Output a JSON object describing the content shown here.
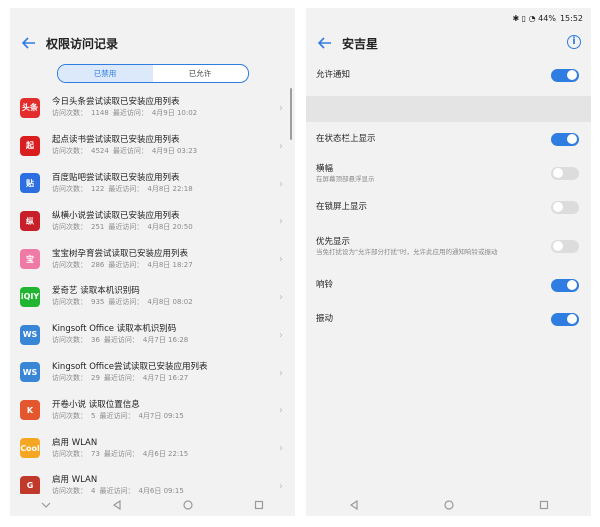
{
  "left": {
    "title": "权限访问记录",
    "tabs": [
      {
        "label": "已禁用",
        "active": true
      },
      {
        "label": "已允许",
        "active": false
      }
    ],
    "items": [
      {
        "app": "今日头条",
        "title": "今日头条尝试读取已安装应用列表",
        "count_label": "访问次数：",
        "count": "1148",
        "last_label": "最近访问：",
        "last": "4月9日 10:02",
        "icon_color": "#e32d2d",
        "icon_text": "头条"
      },
      {
        "app": "起点读书",
        "title": "起点读书尝试读取已安装应用列表",
        "count_label": "访问次数：",
        "count": "4524",
        "last_label": "最近访问：",
        "last": "4月9日 03:23",
        "icon_color": "#d81e1e",
        "icon_text": "起"
      },
      {
        "app": "百度贴吧",
        "title": "百度贴吧尝试读取已安装应用列表",
        "count_label": "访问次数：",
        "count": "122",
        "last_label": "最近访问：",
        "last": "4月8日 22:18",
        "icon_color": "#2d6fe0",
        "icon_text": "贴"
      },
      {
        "app": "纵横小说",
        "title": "纵横小说尝试读取已安装应用列表",
        "count_label": "访问次数：",
        "count": "251",
        "last_label": "最近访问：",
        "last": "4月8日 20:50",
        "icon_color": "#c8202a",
        "icon_text": "纵"
      },
      {
        "app": "宝宝树孕育",
        "title": "宝宝树孕育尝试读取已安装应用列表",
        "count_label": "访问次数：",
        "count": "286",
        "last_label": "最近访问：",
        "last": "4月8日 18:27",
        "icon_color": "#ee7aa5",
        "icon_text": "宝"
      },
      {
        "app": "爱奇艺",
        "title": "爱奇艺 读取本机识别码",
        "count_label": "访问次数：",
        "count": "935",
        "last_label": "最近访问：",
        "last": "4月8日 08:02",
        "icon_color": "#21b531",
        "icon_text": "iQIY"
      },
      {
        "app": "Kingsoft Office",
        "title": "Kingsoft Office 读取本机识别码",
        "count_label": "访问次数：",
        "count": "36",
        "last_label": "最近访问：",
        "last": "4月7日 16:28",
        "icon_color": "#3a86d6",
        "icon_text": "WS"
      },
      {
        "app": "Kingsoft Office",
        "title": "Kingsoft Office尝试读取已安装应用列表",
        "count_label": "访问次数：",
        "count": "29",
        "last_label": "最近访问：",
        "last": "4月7日 16:27",
        "icon_color": "#3a86d6",
        "icon_text": "WS"
      },
      {
        "app": "开卷小说",
        "title": "开卷小说 读取位置信息",
        "count_label": "访问次数：",
        "count": "5",
        "last_label": "最近访问：",
        "last": "4月7日 09:15",
        "icon_color": "#e4572e",
        "icon_text": "K"
      },
      {
        "app": "启用 WLAN",
        "title": "启用 WLAN",
        "count_label": "访问次数：",
        "count": "73",
        "last_label": "最近访问：",
        "last": "4月6日 22:15",
        "icon_color": "#f5a623",
        "icon_text": "Cool"
      },
      {
        "app": "启用 WLAN",
        "title": "启用 WLAN",
        "count_label": "访问次数：",
        "count": "4",
        "last_label": "最近访问：",
        "last": "4月6日 09:15",
        "icon_color": "#c0392b",
        "icon_text": "G"
      }
    ]
  },
  "right": {
    "status": {
      "icons": "✱ ▯ ◔ 44%",
      "battery": "44%",
      "time": "15:52"
    },
    "title": "安吉星",
    "settings": [
      {
        "label": "允许通知",
        "sub": "",
        "on": true
      },
      {
        "label": "在状态栏上显示",
        "sub": "",
        "on": true
      },
      {
        "label": "横幅",
        "sub": "在屏幕顶部悬浮显示",
        "on": false
      },
      {
        "label": "在锁屏上显示",
        "sub": "",
        "on": false
      },
      {
        "label": "优先显示",
        "sub": "当免打扰设为\"允许部分打扰\"时，允许此应用的通知响铃或振动",
        "on": false
      },
      {
        "label": "响铃",
        "sub": "",
        "on": true
      },
      {
        "label": "振动",
        "sub": "",
        "on": true
      }
    ]
  },
  "colors": {
    "accent": "#2f7de1",
    "background": "#f2f2f2"
  }
}
